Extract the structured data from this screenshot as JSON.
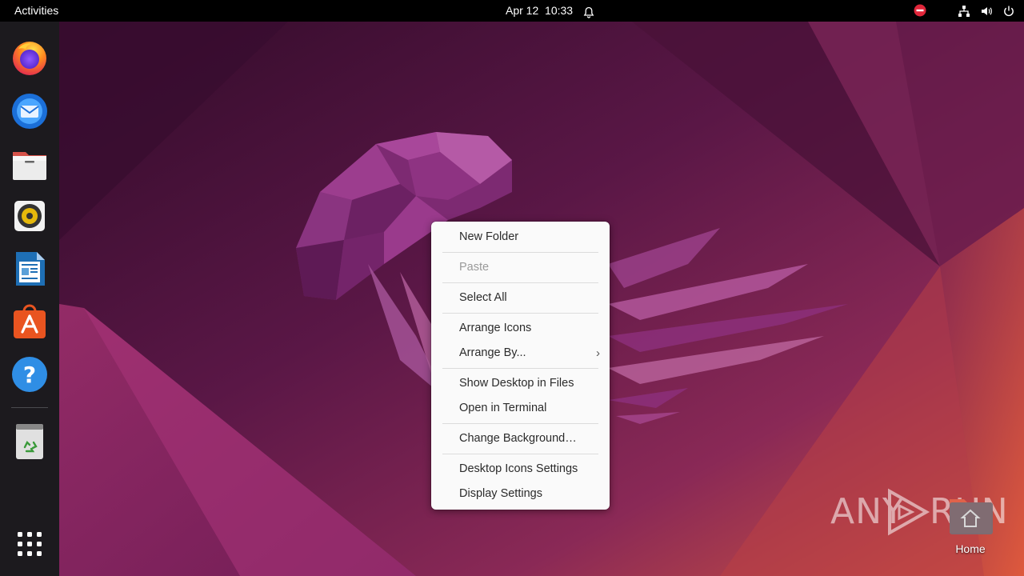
{
  "topbar": {
    "activities_label": "Activities",
    "date": "Apr 12",
    "time": "10:33",
    "icons": [
      "bell-icon",
      "do-not-disturb-icon",
      "network-icon",
      "volume-icon",
      "power-icon"
    ]
  },
  "dock": {
    "apps": [
      {
        "name": "Firefox",
        "icon": "firefox-icon"
      },
      {
        "name": "Thunderbird Mail",
        "icon": "thunderbird-icon"
      },
      {
        "name": "Files",
        "icon": "files-icon"
      },
      {
        "name": "Rhythmbox",
        "icon": "rhythmbox-icon"
      },
      {
        "name": "LibreOffice Writer",
        "icon": "libreoffice-writer-icon"
      },
      {
        "name": "Ubuntu Software",
        "icon": "ubuntu-software-icon"
      },
      {
        "name": "Help",
        "icon": "help-icon"
      },
      {
        "name": "Trash",
        "icon": "trash-icon"
      },
      {
        "name": "Show Applications",
        "icon": "app-grid-icon"
      }
    ]
  },
  "context_menu": {
    "items": [
      {
        "label": "New Folder",
        "enabled": true
      },
      {
        "label": "Paste",
        "enabled": false
      },
      {
        "label": "Select All",
        "enabled": true
      },
      {
        "label": "Arrange Icons",
        "enabled": true
      },
      {
        "label": "Arrange By...",
        "enabled": true,
        "submenu": true
      },
      {
        "label": "Show Desktop in Files",
        "enabled": true
      },
      {
        "label": "Open in Terminal",
        "enabled": true
      },
      {
        "label": "Change Background…",
        "enabled": true
      },
      {
        "label": "Desktop Icons Settings",
        "enabled": true
      },
      {
        "label": "Display Settings",
        "enabled": true
      }
    ],
    "submenu_glyph": "›"
  },
  "desktop": {
    "home_label": "Home",
    "watermark_left": "ANY",
    "watermark_right": "RUN"
  },
  "colors": {
    "topbar": "#000000",
    "dock": "#1c1a1e",
    "menu_bg": "#fafafa",
    "wallpaper_dark": "#3d0d33",
    "wallpaper_mid": "#7a1f5c",
    "wallpaper_accent": "#c8434f"
  }
}
